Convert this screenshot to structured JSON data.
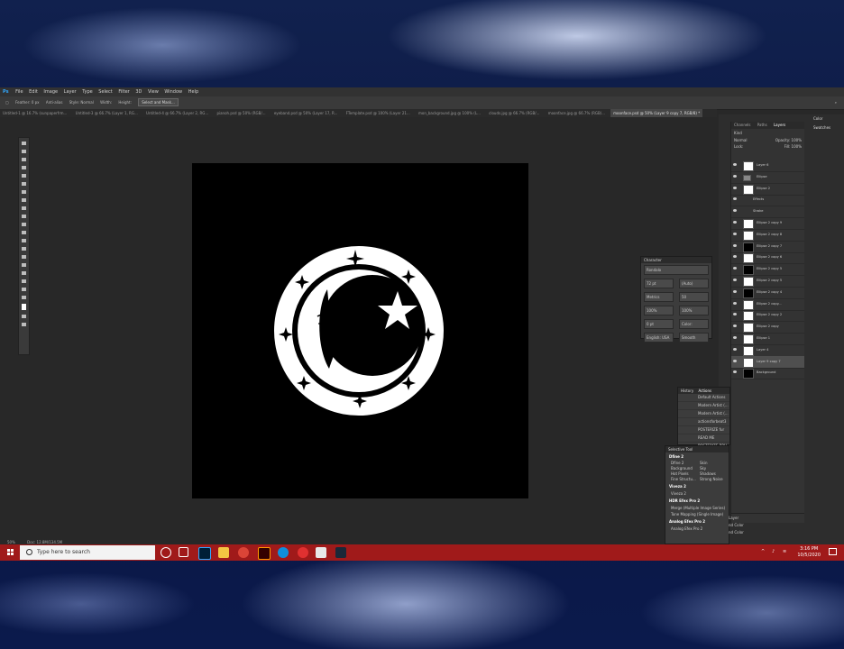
{
  "menubar": {
    "logo": "Ps",
    "items": [
      "File",
      "Edit",
      "Image",
      "Layer",
      "Type",
      "Select",
      "Filter",
      "3D",
      "View",
      "Window",
      "Help"
    ]
  },
  "options": {
    "feather": "Feather: 0 px",
    "antialias": "Anti-alias",
    "style": "Style: Normal",
    "width": "Width:",
    "height": "Height:",
    "select_mask": "Select and Mask..."
  },
  "tabs": [
    "Untitled-1 @ 16.7% (sunpaperfrm...",
    "Untitled-3 @ 66.7% (Layer 1, RG...",
    "Untitled-4 @ 66.7% (Layer 2, RG...",
    "pianoh.psd @ 50% (RGB/...",
    "eyeband.psd @ 50% (Layer 17, R...",
    "FTemplate.psd @ 100% (Layer 21...",
    "mon_background.jpg @ 100% (L...",
    "clouds.jpg @ 66.7% (RGB/...",
    "moonface.jpg @ 66.7% (RGB/...",
    "moonface.psd @ 50% (Layer 9 copy 7, RGB/8) *"
  ],
  "status": {
    "zoom": "50%",
    "doc": "Doc: 12.8M/134.5M"
  },
  "layers_panel": {
    "tabs": [
      "Channels",
      "Paths",
      "Layers"
    ],
    "kind": "Kind",
    "blend": "Normal",
    "opacity": "Opacity: 100%",
    "fill": "Fill: 100%",
    "lock": "Lock:",
    "items": [
      {
        "name": "Layer 6",
        "thumb": "white"
      },
      {
        "name": "Ellipse",
        "thumb": "folder"
      },
      {
        "name": "Ellipse 2",
        "thumb": "white"
      },
      {
        "name": "Effects",
        "thumb": "none"
      },
      {
        "name": "Stroke",
        "thumb": "none"
      },
      {
        "name": "Ellipse 2 copy 9",
        "thumb": "white"
      },
      {
        "name": "Ellipse 2 copy 8",
        "thumb": "white"
      },
      {
        "name": "Ellipse 2 copy 7",
        "thumb": "black"
      },
      {
        "name": "Ellipse 2 copy 6",
        "thumb": "white"
      },
      {
        "name": "Ellipse 2 copy 5",
        "thumb": "black"
      },
      {
        "name": "Ellipse 2 copy 5",
        "thumb": "white"
      },
      {
        "name": "Ellipse 2 copy 4",
        "thumb": "black"
      },
      {
        "name": "Ellipse 2 copy...",
        "thumb": "white"
      },
      {
        "name": "Ellipse 2 copy 2",
        "thumb": "white"
      },
      {
        "name": "Ellipse 2 copy",
        "thumb": "white"
      },
      {
        "name": "Ellipse 1",
        "thumb": "white"
      },
      {
        "name": "Layer 4",
        "thumb": "white"
      },
      {
        "name": "Layer 9 copy 7",
        "thumb": "white"
      },
      {
        "name": "Background",
        "thumb": "black"
      }
    ]
  },
  "color_panel": {
    "items": [
      "Color",
      "Swatches"
    ]
  },
  "character_panel": {
    "title": "Character",
    "font": "Rondalo",
    "size": "72 pt",
    "leading": "(Auto)",
    "kerning": "Metrics",
    "tracking": "50",
    "vscale": "100%",
    "hscale": "100%",
    "baseline": "0 pt",
    "color_label": "Color:",
    "language": "English: USA",
    "aa": "Smooth"
  },
  "actions_panel": {
    "tabs": [
      "History",
      "Actions"
    ],
    "items": [
      "Default Actions",
      "Modern Artist (...",
      "Modern Artist (...",
      "actionsforbeat3",
      "POSTERIZE fur",
      "READ ME",
      "POSTERIZE BPH"
    ]
  },
  "selective_tool": {
    "title": "Selective Tool",
    "sec1": "Dfine 2",
    "grid1": [
      "Dfine 2",
      "Skin",
      "Background",
      "Sky",
      "Hot Pixels",
      "Shadows",
      "Fine Structu...",
      "Strong Noise"
    ],
    "sec2": "Viveza 2",
    "line2": "Viveza 2",
    "sec3": "HDR Efex Pro 2",
    "line3a": "Merge (Multiple Image Series)",
    "line3b": "Tone Mapping (Single Image)",
    "sec4": "Analog Efex Pro 2",
    "line4": "Analog Efex Pro 2"
  },
  "props_peek": {
    "a": "Layer",
    "b": "nd Color",
    "c": "nd Color"
  },
  "taskbar": {
    "search": "Type here to search",
    "time": "3:16 PM",
    "date": "10/5/2020"
  }
}
